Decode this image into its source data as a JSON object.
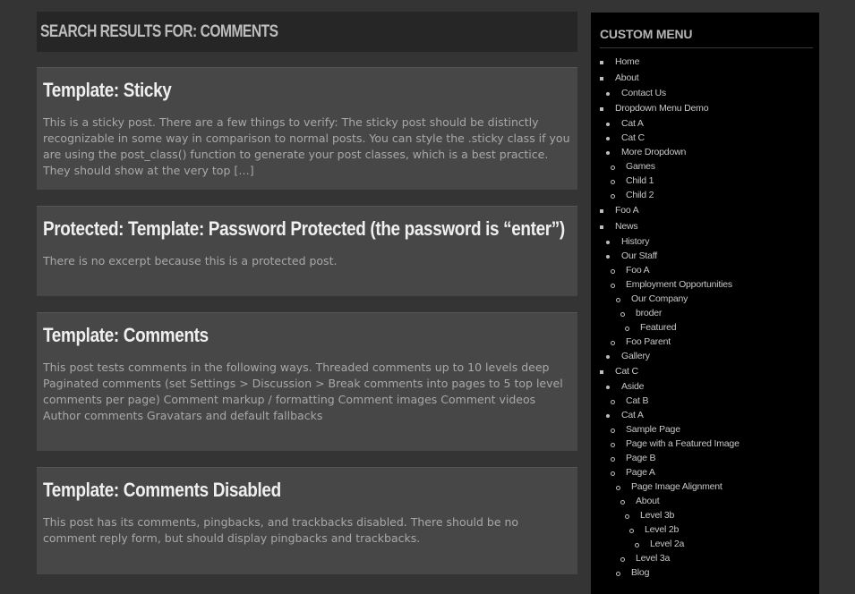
{
  "header": {
    "title": "SEARCH RESULTS FOR: COMMENTS"
  },
  "posts": [
    {
      "title": "Template: Sticky",
      "excerpt": "This is a sticky post. There are a few things to verify: The sticky post should be distinctly recognizable in some way in comparison to normal posts. You can style the .sticky class if you are using the post_class() function to generate your post classes, which is a best practice. They should show at the very top […]"
    },
    {
      "title": "Protected: Template: Password Protected (the password is “enter”)",
      "excerpt": "There is no excerpt because this is a protected post."
    },
    {
      "title": "Template: Comments",
      "excerpt": "This post tests comments in the following ways. Threaded comments up to 10 levels deep Paginated comments (set Settings > Discussion > Break comments into pages to 5 top level comments per page) Comment markup / formatting Comment images Comment videos Author comments Gravatars and default fallbacks"
    },
    {
      "title": "Template: Comments Disabled",
      "excerpt": "This post has its comments, pingbacks, and trackbacks disabled. There should be no comment reply form, but should display pingbacks and trackbacks."
    }
  ],
  "sidebar": {
    "title": "CUSTOM MENU",
    "items": [
      "Home",
      "About",
      "Contact Us",
      "Dropdown Menu Demo",
      "Cat A",
      "Cat C",
      "More Dropdown",
      "Games",
      "Child 1",
      "Child 2",
      "Foo A",
      "News",
      "History",
      "Our Staff",
      "Foo A",
      "Employment Opportunities",
      "Our Company",
      "broder",
      "Featured",
      "Foo Parent",
      "Gallery",
      "Cat C",
      "Aside",
      "Cat B",
      "Cat A",
      "Sample Page",
      "Page with a Featured Image",
      "Page B",
      "Page A",
      "Page Image Alignment",
      "About",
      "Level 3b",
      "Level 2b",
      "Level 2a",
      "Level 3a",
      "Blog"
    ]
  }
}
